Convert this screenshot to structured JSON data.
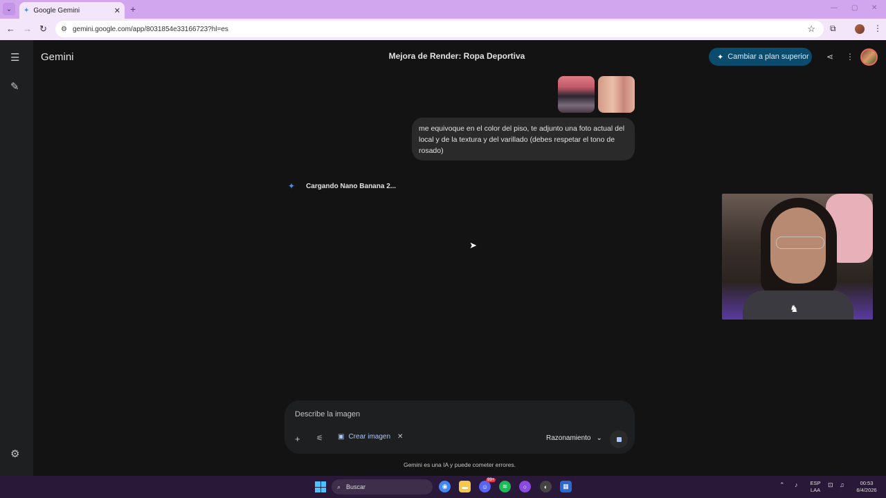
{
  "browser": {
    "tab_title": "Google Gemini",
    "url": "gemini.google.com/app/8031854e331667​23?hl=es"
  },
  "app": {
    "brand": "Gemini",
    "conversation_title": "Mejora de Render: Ropa Deportiva",
    "upgrade_label": "Cambiar a plan superior"
  },
  "chat": {
    "user_message": "me equivoque en el color del piso, te adjunto una foto actual del local y de la textura y del varillado (debes respetar el tono de rosado)",
    "loading_text": "Cargando Nano Banana 2..."
  },
  "composer": {
    "placeholder": "Describe la imagen",
    "chip_label": "Crear imagen",
    "mode_label": "Razonamiento"
  },
  "footer": {
    "disclaimer": "Gemini es una IA y puede cometer errores."
  },
  "taskbar": {
    "search_label": "Buscar",
    "lang_top": "ESP",
    "lang_bottom": "LAA",
    "time": "00:53",
    "date": "6/4/2026",
    "discord_badge": "99+"
  },
  "icons": [
    "menu-icon",
    "edit-icon",
    "settings-icon",
    "share-icon",
    "more-icon",
    "spark-icon",
    "plus-icon",
    "tools-icon",
    "image-icon",
    "close-icon",
    "chevron-down-icon",
    "stop-icon",
    "search-icon"
  ],
  "colors": {
    "background": "#131314",
    "sidebar": "#1e1f20",
    "upgrade_button": "#0b4b6e",
    "accent": "#a8c7fa",
    "tabbar": "#d2a6ee"
  }
}
